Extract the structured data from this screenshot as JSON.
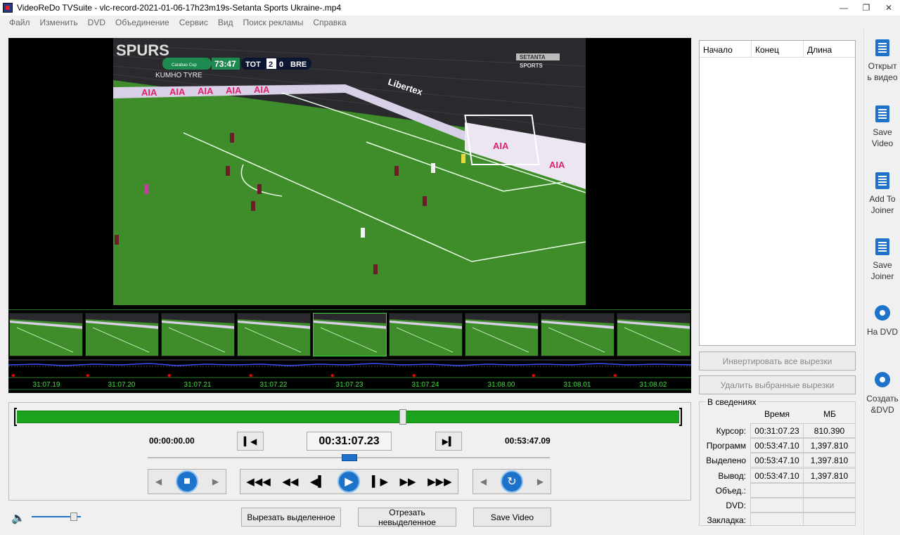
{
  "window": {
    "title": "VideoReDo TVSuite - vlc-record-2021-01-06-17h23m19s-Setanta Sports Ukraine-.mp4",
    "minimize": "—",
    "restore": "❐",
    "close": "✕"
  },
  "menu": [
    "Файл",
    "Изменить",
    "DVD",
    "Объединение",
    "Сервис",
    "Вид",
    "Поиск рекламы",
    "Справка"
  ],
  "video": {
    "scoreboard": {
      "competition": "Carabao Cup",
      "clock": "73:47",
      "home": "TOT",
      "home_score": "2",
      "away_score": "0",
      "away": "BRE"
    },
    "channel_logo_line1": "SETANTA",
    "channel_logo_line2": "SPORTS",
    "ad_boards": [
      "AIA",
      "AIA",
      "AIA",
      "AIA",
      "AIA",
      "AIA",
      "AIA"
    ],
    "sponsor": "Libertex",
    "stand_text": "KUMHO TYRE",
    "stand_text2": "SPURS"
  },
  "timeline": {
    "labels": [
      "31:07.19",
      "31:07.20",
      "31:07.21",
      "31:07.22",
      "31:07.23",
      "31:07.24",
      "31:08.00",
      "31:08.01",
      "31:08.02"
    ]
  },
  "transport": {
    "start_time": "00:00:00.00",
    "current_time": "00:31:07.23",
    "end_time": "00:53:47.09",
    "position_fraction": 0.583,
    "seek_fraction": 0.5,
    "volume_fraction": 0.85,
    "set_start_label": "▍◀",
    "set_end_label": "▶▍",
    "cut_selected": "Вырезать выделенное",
    "trim_unselected_line1": "Отрезать",
    "trim_unselected_line2": "невыделенное",
    "save_video": "Save Video"
  },
  "cuts": {
    "columns": [
      "Начало",
      "Конец",
      "Длина"
    ],
    "invert_button": "Инвертировать все вырезки",
    "delete_button": "Удалить выбранные вырезки"
  },
  "info": {
    "legend": "В сведениях",
    "col_time": "Время",
    "col_mb": "МБ",
    "rows": [
      {
        "label": "Курсор:",
        "time": "00:31:07.23",
        "mb": "810.390"
      },
      {
        "label": "Программ",
        "time": "00:53:47.10",
        "mb": "1,397.810"
      },
      {
        "label": "Выделено",
        "time": "00:53:47.10",
        "mb": "1,397.810"
      },
      {
        "label": "Вывод:",
        "time": "00:53:47.10",
        "mb": "1,397.810"
      },
      {
        "label": "Объед.:",
        "time": "",
        "mb": ""
      },
      {
        "label": "DVD:",
        "time": "",
        "mb": ""
      },
      {
        "label": "Закладка:",
        "time": "",
        "mb": ""
      }
    ]
  },
  "sidebar": [
    {
      "line1": "Открыт",
      "line2": "ь видео",
      "icon": "open-video-icon"
    },
    {
      "line1": "Save",
      "line2": "Video",
      "icon": "save-video-icon"
    },
    {
      "line1": "Add To",
      "line2": "Joiner",
      "icon": "add-joiner-icon"
    },
    {
      "line1": "Save",
      "line2": "Joiner",
      "icon": "save-joiner-icon"
    },
    {
      "line1": "На DVD",
      "line2": "",
      "icon": "dvd-icon"
    },
    {
      "line1": "Создать",
      "line2": "&DVD",
      "icon": "create-dvd-icon"
    }
  ],
  "colors": {
    "accent": "#1c73c9",
    "progress": "#1da21d",
    "timeline_text": "#3fe03f"
  }
}
